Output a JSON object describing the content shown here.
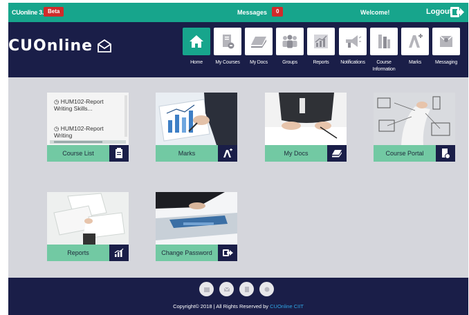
{
  "topbar": {
    "brand": "CUonline 3.0",
    "beta": "Beta",
    "messages_label": "Messages",
    "messages_count": "0",
    "welcome": "Welcome!",
    "logout": "Logout"
  },
  "header": {
    "logo_text": "CUOnline",
    "nav": [
      {
        "label": "Home",
        "icon": "home-icon"
      },
      {
        "label": "My Courses",
        "icon": "courses-icon"
      },
      {
        "label": "My Docs",
        "icon": "docs-icon"
      },
      {
        "label": "Groups",
        "icon": "groups-icon"
      },
      {
        "label": "Reports",
        "icon": "reports-icon"
      },
      {
        "label": "Notifications",
        "icon": "megaphone-icon"
      },
      {
        "label": "Course Information",
        "icon": "info-icon"
      },
      {
        "label": "Marks",
        "icon": "marks-icon"
      },
      {
        "label": "Messaging",
        "icon": "messaging-icon"
      }
    ]
  },
  "cards": {
    "course_list": {
      "label": "Course List",
      "items": [
        "HUM102-Report Writing Skills...",
        "HUM102-Report Writing"
      ]
    },
    "marks": {
      "label": "Marks"
    },
    "my_docs": {
      "label": "My Docs"
    },
    "course_portal": {
      "label": "Course Portal"
    },
    "reports": {
      "label": "Reports"
    },
    "change_password": {
      "label": "Change Password"
    }
  },
  "footer": {
    "copyright": "Copyright© 2018 | All Rights Reserved by ",
    "link": "CUOnline CIIT"
  },
  "colors": {
    "teal": "#17a58c",
    "navy": "#1a1e48",
    "mint": "#72c9a3",
    "red": "#d12b2b",
    "grey": "#d5d6dc"
  }
}
